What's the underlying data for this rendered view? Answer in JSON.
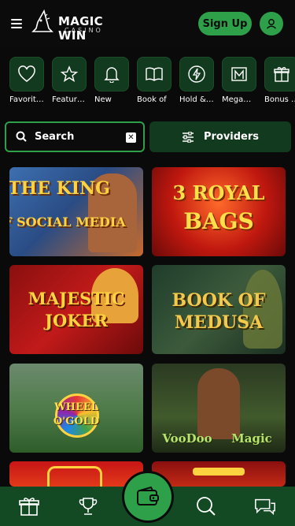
{
  "header": {
    "brand_name": "MAGIC WIN",
    "brand_sub": "CASINO",
    "signup_label": "Sign Up"
  },
  "categories": [
    {
      "label": "Favorit…",
      "icon": "heart-icon"
    },
    {
      "label": "Featur…",
      "icon": "star-icon"
    },
    {
      "label": "New",
      "icon": "bell-icon"
    },
    {
      "label": "Book of",
      "icon": "book-icon"
    },
    {
      "label": "Hold &…",
      "icon": "lightning-icon"
    },
    {
      "label": "Mega…",
      "icon": "mega-icon"
    },
    {
      "label": "Bonus …",
      "icon": "gift-icon"
    }
  ],
  "search": {
    "label": "Search"
  },
  "providers": {
    "label": "Providers"
  },
  "games": [
    {
      "line1": "THE KING",
      "line2": "OF SOCIAL MEDIA"
    },
    {
      "line1": "3 ROYAL",
      "line2": "BAGS"
    },
    {
      "line1": "MAJESTIC",
      "line2": "JOKER"
    },
    {
      "line1": "BOOK OF",
      "line2": "MEDUSA"
    },
    {
      "line1": "WHEEL",
      "line2": "O'GOLD"
    },
    {
      "line1": "VooDoo",
      "line2": "Magic"
    },
    {
      "line1": "",
      "line2": ""
    },
    {
      "line1": "",
      "line2": ""
    }
  ],
  "colors": {
    "accent": "#2fa04a",
    "panel": "#123a1f",
    "nav": "#134a24"
  }
}
